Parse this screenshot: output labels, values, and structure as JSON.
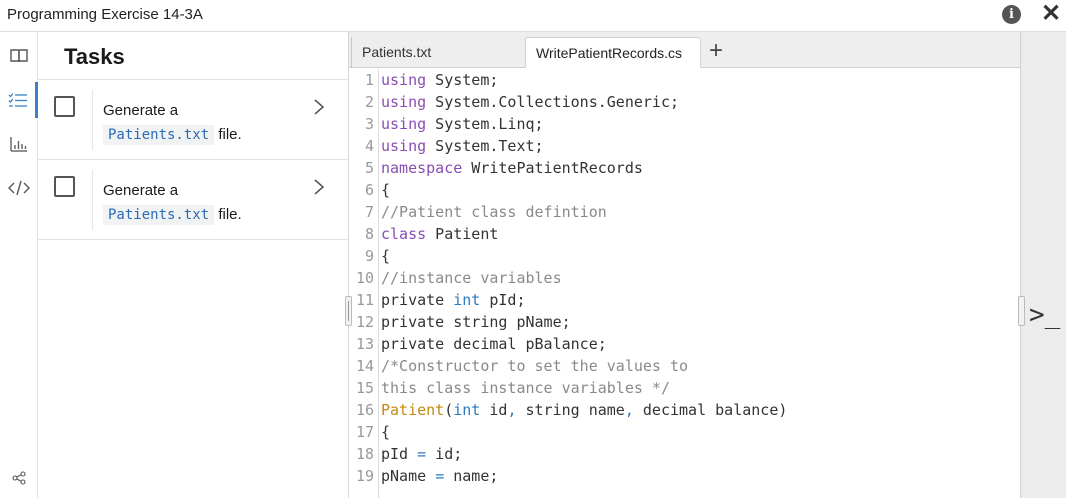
{
  "window": {
    "title": "Programming Exercise 14-3A"
  },
  "rail": {
    "items": [
      {
        "icon": "book-icon"
      },
      {
        "icon": "task-list-icon",
        "active": true
      },
      {
        "icon": "bar-chart-icon"
      },
      {
        "icon": "code-icon"
      }
    ],
    "bottom_icon": "share-icon"
  },
  "tasks": {
    "heading": "Tasks",
    "items": [
      {
        "prefix": "Generate a",
        "code": "Patients.txt",
        "suffix": " file."
      },
      {
        "prefix": "Generate a",
        "code": "Patients.txt",
        "suffix": " file."
      }
    ]
  },
  "editor": {
    "tabs": [
      {
        "label": "Patients.txt",
        "active": false
      },
      {
        "label": "WritePatientRecords.cs",
        "active": true
      }
    ],
    "add_tab_label": "+",
    "lines": [
      {
        "n": "1",
        "tokens": [
          [
            "kw",
            "using"
          ],
          [
            "",
            " System;"
          ]
        ]
      },
      {
        "n": "2",
        "tokens": [
          [
            "kw",
            "using"
          ],
          [
            "",
            " System.Collections.Generic;"
          ]
        ]
      },
      {
        "n": "3",
        "tokens": [
          [
            "kw",
            "using"
          ],
          [
            "",
            " System.Linq;"
          ]
        ]
      },
      {
        "n": "4",
        "tokens": [
          [
            "kw",
            "using"
          ],
          [
            "",
            " System.Text;"
          ]
        ]
      },
      {
        "n": "5",
        "tokens": [
          [
            "kw",
            "namespace"
          ],
          [
            "",
            " WritePatientRecords"
          ]
        ]
      },
      {
        "n": "6",
        "tokens": [
          [
            "",
            "{"
          ]
        ]
      },
      {
        "n": "7",
        "tokens": [
          [
            "cm",
            "//Patient class defintion"
          ]
        ]
      },
      {
        "n": "8",
        "tokens": [
          [
            "kw",
            "class"
          ],
          [
            "",
            " Patient"
          ]
        ]
      },
      {
        "n": "9",
        "tokens": [
          [
            "",
            "{"
          ]
        ]
      },
      {
        "n": "10",
        "tokens": [
          [
            "cm",
            "//instance variables"
          ]
        ]
      },
      {
        "n": "11",
        "tokens": [
          [
            "",
            "private "
          ],
          [
            "ty",
            "int"
          ],
          [
            "",
            " pId;"
          ]
        ]
      },
      {
        "n": "12",
        "tokens": [
          [
            "",
            "private string pName;"
          ]
        ]
      },
      {
        "n": "13",
        "tokens": [
          [
            "",
            "private decimal pBalance;"
          ]
        ]
      },
      {
        "n": "14",
        "tokens": [
          [
            "cm",
            "/*Constructor to set the values to"
          ]
        ]
      },
      {
        "n": "15",
        "tokens": [
          [
            "cm",
            "this class instance variables */"
          ]
        ]
      },
      {
        "n": "16",
        "tokens": [
          [
            "fn",
            "Patient"
          ],
          [
            "",
            "("
          ],
          [
            "ty",
            "int"
          ],
          [
            "",
            " id"
          ],
          [
            "op",
            ","
          ],
          [
            "",
            " string name"
          ],
          [
            "op",
            ","
          ],
          [
            "",
            " decimal balance)"
          ]
        ]
      },
      {
        "n": "17",
        "tokens": [
          [
            "",
            "{"
          ]
        ]
      },
      {
        "n": "18",
        "tokens": [
          [
            "",
            "pId "
          ],
          [
            "op",
            "="
          ],
          [
            "",
            " id;"
          ]
        ]
      },
      {
        "n": "19",
        "tokens": [
          [
            "",
            "pName "
          ],
          [
            "op",
            "="
          ],
          [
            "",
            " name;"
          ]
        ]
      }
    ]
  },
  "terminal": {
    "icon": "terminal-icon",
    "glyph": ">_"
  }
}
